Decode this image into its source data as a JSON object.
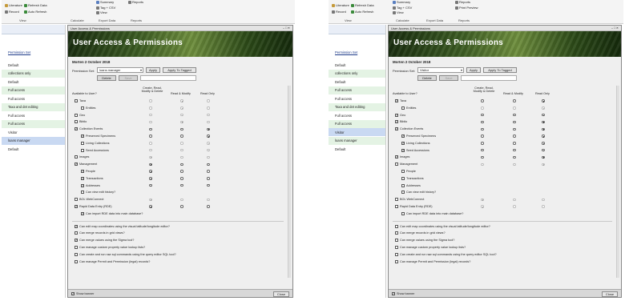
{
  "left": {
    "ribbon": {
      "summary": "Summary",
      "reports": "Reports",
      "literature": "Literature",
      "refresh_data": "Refresh Data",
      "tag_csv": "Tag + CSV",
      "record": "Record",
      "auto_refresh": "Auto Refresh",
      "view_btn": "View",
      "groups": [
        "View",
        "Calculate",
        "Export Data",
        "Reports"
      ]
    },
    "sidebar": {
      "header": "Permission Set",
      "items": [
        "Default",
        "collections only",
        "Default",
        "Full access",
        "Full access",
        "Taxa and det editing",
        "Full access",
        "Full access",
        "Visitor",
        "loans manager",
        "Default"
      ],
      "selected_index": 9
    },
    "dialog": {
      "window_title": "User Access & Permissions",
      "banner_title": "User Access & Permissions",
      "subtitle": "Morten 2 October 2018",
      "permission_set_label": "Permission Set:",
      "permission_set_value": "loans manager",
      "apply": "Apply",
      "apply_to_tagged": "Apply To Tagged",
      "delete": "Delete",
      "save": "Save",
      "available_label": "Available to User?",
      "col_cmd": "Create, Read, Modify & Delete",
      "col_rm": "Read & Modify",
      "col_ro": "Read Only",
      "modules": [
        {
          "label": "Taxa",
          "checked": false,
          "indent": 0,
          "sel": 1
        },
        {
          "label": "Entities",
          "checked": false,
          "indent": 1,
          "sel": 1
        },
        {
          "label": "Geo",
          "checked": false,
          "indent": 0,
          "sel": 1
        },
        {
          "label": "Biblio",
          "checked": false,
          "indent": 0,
          "sel": 1
        },
        {
          "label": "Collection Events",
          "checked": true,
          "indent": 0,
          "sel": 2
        },
        {
          "label": "Preserved Specimens",
          "checked": true,
          "indent": 1,
          "sel": 2
        },
        {
          "label": "Living Collections",
          "checked": false,
          "indent": 1,
          "sel": 2
        },
        {
          "label": "Seed Accessions",
          "checked": false,
          "indent": 1,
          "sel": 2
        },
        {
          "label": "Images",
          "checked": false,
          "indent": 0,
          "sel": 0
        },
        {
          "label": "Management",
          "checked": true,
          "indent": 0,
          "sel": 0
        },
        {
          "label": "People",
          "checked": true,
          "indent": 1,
          "sel": 0
        },
        {
          "label": "Transactions",
          "checked": true,
          "indent": 1,
          "sel": 0
        },
        {
          "label": "Addresses",
          "checked": true,
          "indent": 1,
          "sel": 0
        },
        {
          "label": "Can view edit history?",
          "checked": false,
          "indent": 1,
          "sel": -1
        },
        {
          "label": "BOL WebConnect",
          "checked": false,
          "indent": 0,
          "sel": 0
        },
        {
          "label": "Rapid Data Entry (RDE)",
          "checked": true,
          "indent": 0,
          "sel": 0
        },
        {
          "label": "Can import RDE data into main database?",
          "checked": true,
          "indent": 1,
          "sel": -1
        }
      ],
      "options": [
        {
          "label": "Can edit map coordinates using the visual latitude/longitude editor?",
          "checked": true
        },
        {
          "label": "Can merge records in grid views?",
          "checked": false
        },
        {
          "label": "Can merge values using the Sigma tool?",
          "checked": true
        },
        {
          "label": "Can manage custom property value lookup lists?",
          "checked": false
        },
        {
          "label": "Can create and run raw sql commands using the query editor SQL tool?",
          "checked": false
        },
        {
          "label": "Can manage Permit and Permission (legal) records?",
          "checked": false
        }
      ],
      "show_banner": "Show banner",
      "close": "Close"
    }
  },
  "right": {
    "ribbon": {
      "summary": "Summary",
      "reports": "Reports",
      "literature": "Literature",
      "refresh_data": "Refresh Data",
      "tag_csv": "Tag + CSV",
      "record": "Record",
      "auto_refresh": "Auto Refresh",
      "view_btn": "View",
      "print_preview": "Print Preview",
      "groups": [
        "View",
        "Calculate",
        "Export Data",
        "Reports"
      ]
    },
    "sidebar": {
      "header": "Permission Set",
      "items": [
        "Default",
        "collections only",
        "Default",
        "Full access",
        "Full access",
        "Taxa and det editing",
        "Full access",
        "Full access",
        "Visitor",
        "loans manager",
        "Default"
      ],
      "selected_index": 8
    },
    "dialog": {
      "window_title": "User Access & Permissions",
      "banner_title": "User Access & Permissions",
      "subtitle": "Morten 2 October 2018",
      "permission_set_label": "Permission Set:",
      "permission_set_value": "Visitor",
      "apply": "Apply",
      "apply_to_tagged": "Apply To Tagged",
      "delete": "Delete",
      "save": "Save",
      "available_label": "Available to User?",
      "col_cmd": "Create, Read, Modify & Delete",
      "col_rm": "Read & Modify",
      "col_ro": "Read Only",
      "modules": [
        {
          "label": "Taxa",
          "checked": true,
          "indent": 0,
          "sel": 2
        },
        {
          "label": "Entities",
          "checked": false,
          "indent": 1,
          "sel": 2
        },
        {
          "label": "Geo",
          "checked": true,
          "indent": 0,
          "sel": 2
        },
        {
          "label": "Biblio",
          "checked": true,
          "indent": 0,
          "sel": 2
        },
        {
          "label": "Collection Events",
          "checked": true,
          "indent": 0,
          "sel": 2
        },
        {
          "label": "Preserved Specimens",
          "checked": true,
          "indent": 1,
          "sel": 2
        },
        {
          "label": "Living Collections",
          "checked": true,
          "indent": 1,
          "sel": 2
        },
        {
          "label": "Seed Accessions",
          "checked": true,
          "indent": 1,
          "sel": 2
        },
        {
          "label": "Images",
          "checked": true,
          "indent": 0,
          "sel": 2
        },
        {
          "label": "Management",
          "checked": false,
          "indent": 0,
          "sel": 2
        },
        {
          "label": "People",
          "checked": false,
          "indent": 1,
          "sel": -1
        },
        {
          "label": "Transactions",
          "checked": false,
          "indent": 1,
          "sel": -1
        },
        {
          "label": "Addresses",
          "checked": false,
          "indent": 1,
          "sel": -1
        },
        {
          "label": "Can view edit history?",
          "checked": false,
          "indent": 1,
          "sel": -1
        },
        {
          "label": "BOL WebConnect",
          "checked": false,
          "indent": 0,
          "sel": 0
        },
        {
          "label": "Rapid Data Entry (RDE)",
          "checked": false,
          "indent": 0,
          "sel": 0
        },
        {
          "label": "Can import RDE data into main database?",
          "checked": false,
          "indent": 1,
          "sel": -1
        }
      ],
      "options": [
        {
          "label": "Can edit map coordinates using the visual latitude/longitude editor?",
          "checked": false
        },
        {
          "label": "Can merge records in grid views?",
          "checked": false
        },
        {
          "label": "Can merge values using the Sigma tool?",
          "checked": false
        },
        {
          "label": "Can manage custom property value lookup lists?",
          "checked": false
        },
        {
          "label": "Can create and run raw sql commands using the query editor SQL tool?",
          "checked": false
        },
        {
          "label": "Can manage Permit and Permission (legal) records?",
          "checked": false
        }
      ],
      "show_banner": "Show banner",
      "close": "Close"
    }
  },
  "colors": {
    "sidebar_green": "#e4f3e4",
    "sidebar_selected": "#c9d9f2",
    "sidebar_header": "#e9eef7",
    "link_blue": "#1f3b8a"
  }
}
